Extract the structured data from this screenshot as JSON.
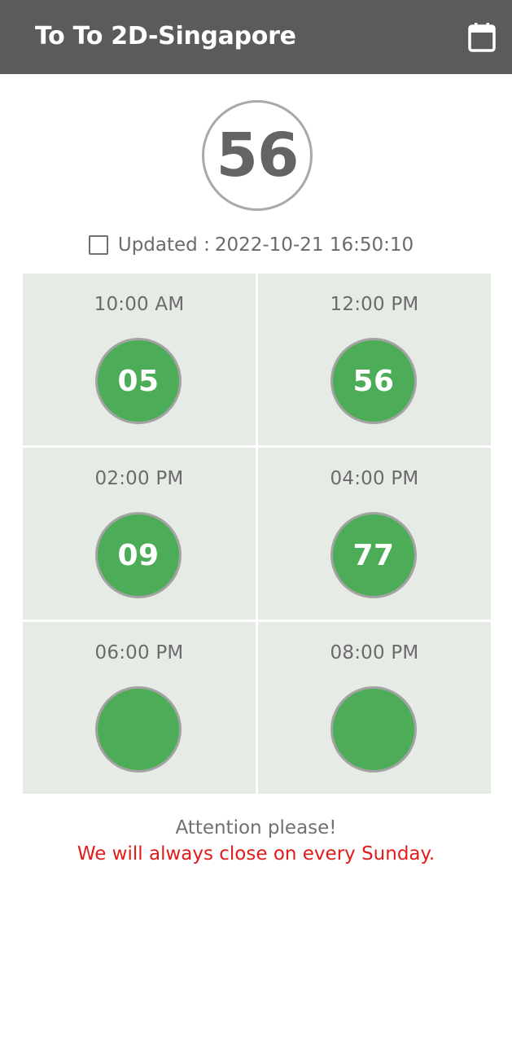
{
  "header": {
    "title": "To To 2D-Singapore",
    "calendar_icon": "calendar-icon"
  },
  "current": {
    "number": "56"
  },
  "updated": {
    "label": "Updated :",
    "value": "2022-10-21 16:50:10"
  },
  "results": [
    {
      "time": "10:00 AM",
      "number": "05"
    },
    {
      "time": "12:00 PM",
      "number": "56"
    },
    {
      "time": "02:00 PM",
      "number": "09"
    },
    {
      "time": "04:00 PM",
      "number": "77"
    },
    {
      "time": "06:00 PM",
      "number": ""
    },
    {
      "time": "08:00 PM",
      "number": ""
    }
  ],
  "notice": {
    "attention": "Attention please!",
    "message": "We will always close on every Sunday."
  },
  "colors": {
    "appbar": "#5b5b5b",
    "ball": "#4cac58",
    "cell_bg": "#e6ebe6",
    "notice_red": "#e21b1b"
  }
}
